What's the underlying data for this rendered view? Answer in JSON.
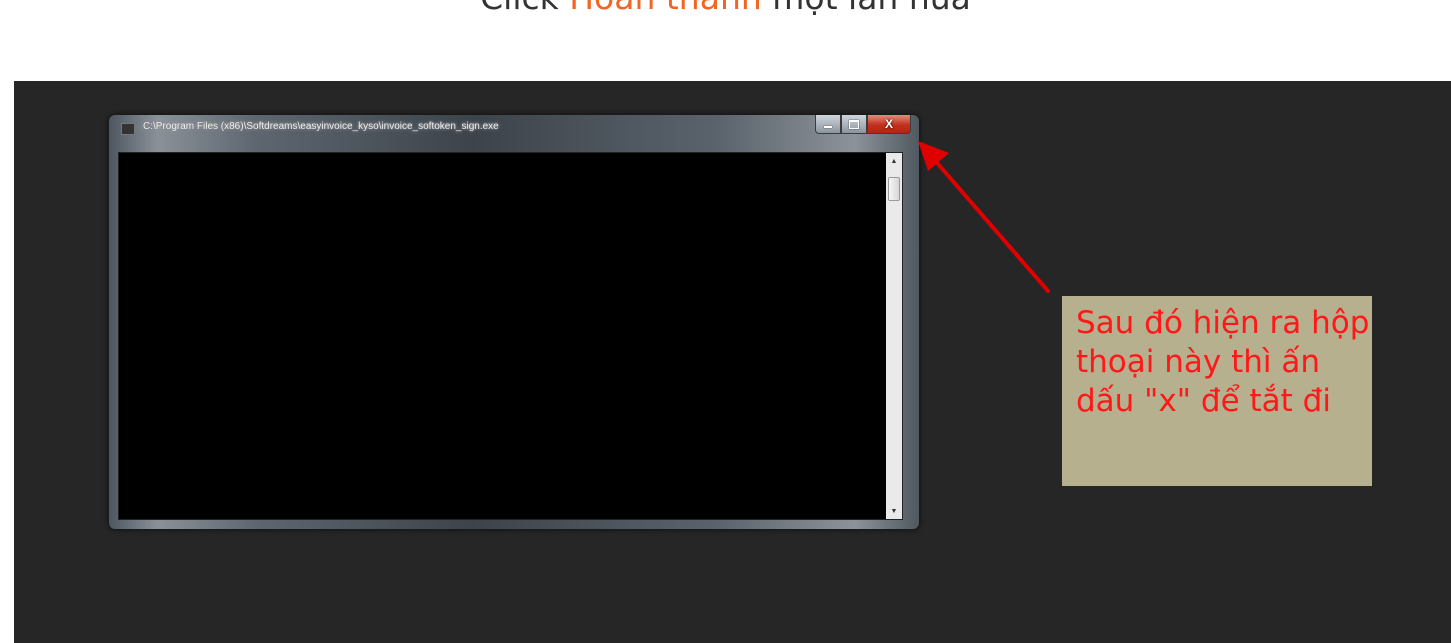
{
  "heading": {
    "prefix": "Click ",
    "highlight": "Hoàn thành",
    "suffix": " một lần nữa",
    "highlight_color": "#f26522"
  },
  "console_window": {
    "title": "C:\\Program Files (x86)\\Softdreams\\easyinvoice_kyso\\invoice_softoken_sign.exe",
    "close_glyph": "X",
    "icons": [
      "minimize-icon",
      "maximize-icon",
      "close-icon",
      "scroll-up-icon",
      "scroll-down-icon"
    ]
  },
  "callout": {
    "text": "Sau đó hiện ra hộp thoại này thì ấn dấu \"x\" để tắt đi",
    "text_color": "#ff1818",
    "background": "#b6b08f"
  },
  "colors": {
    "backdrop": "#262626",
    "arrow": "#e00000"
  }
}
